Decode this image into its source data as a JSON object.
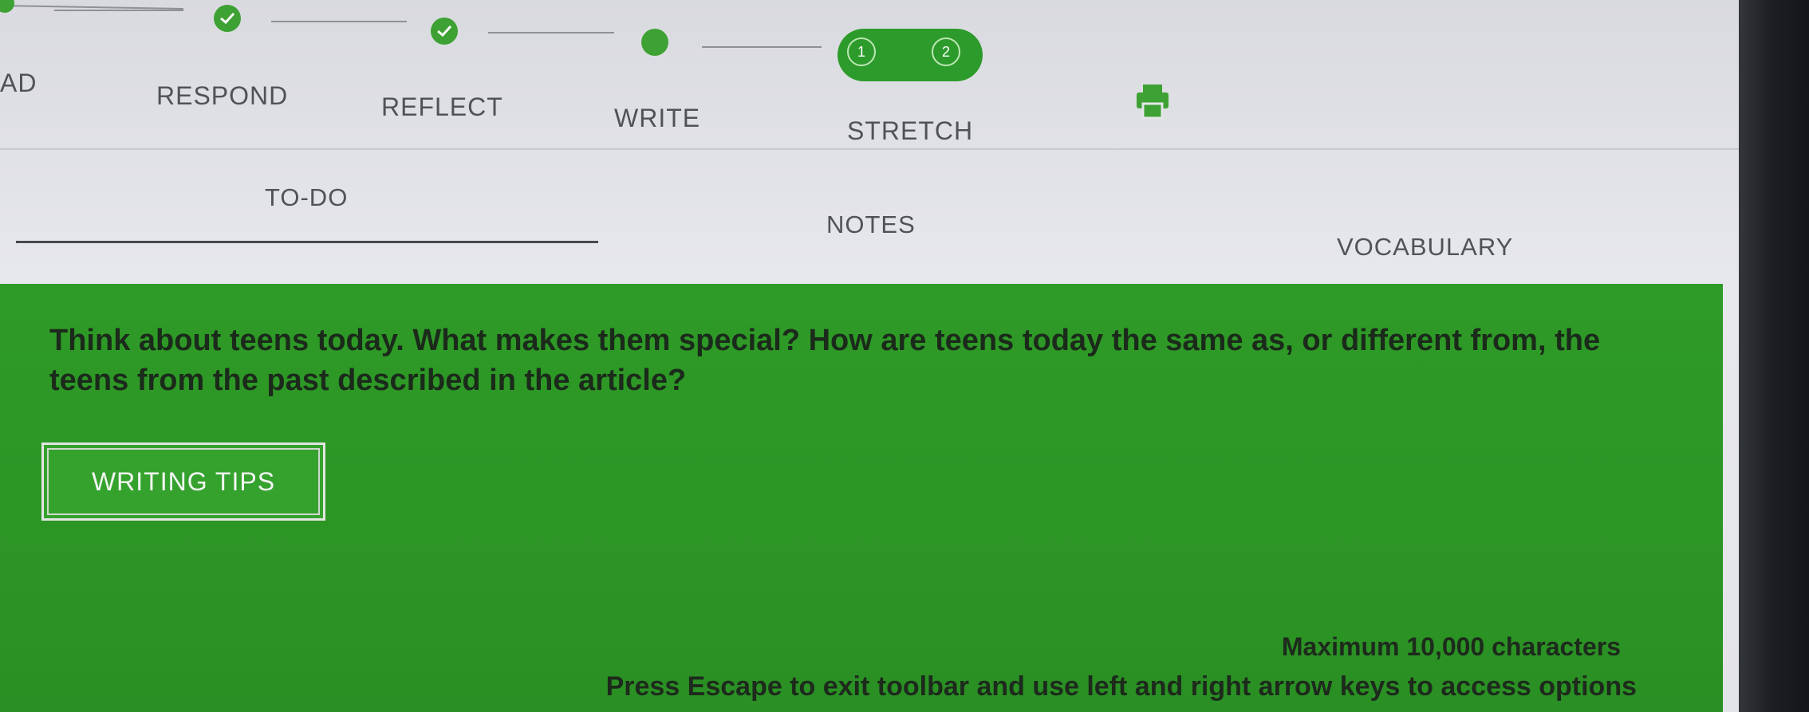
{
  "progress": {
    "steps": [
      {
        "name": "step-1",
        "state": "complete"
      },
      {
        "name": "step-2",
        "state": "complete"
      },
      {
        "name": "step-3",
        "state": "complete"
      },
      {
        "name": "step-4",
        "state": "current"
      },
      {
        "name": "step-5",
        "state": "in-progress"
      }
    ],
    "substeps": [
      "1",
      "2"
    ]
  },
  "nav": {
    "items": [
      {
        "label": "AD"
      },
      {
        "label": "RESPOND"
      },
      {
        "label": "REFLECT"
      },
      {
        "label": "WRITE"
      },
      {
        "label": "STRETCH"
      }
    ]
  },
  "tabs": [
    {
      "label": "TO-DO",
      "active": true
    },
    {
      "label": "NOTES",
      "active": false
    },
    {
      "label": "VOCABULARY",
      "active": false
    }
  ],
  "panel": {
    "prompt": "Think about teens today. What makes them special? How are teens today the same as, or different from, the teens from the past described in the article?",
    "writing_tips_label": "WRITING TIPS",
    "max_chars": "Maximum 10,000 characters",
    "escape_hint": "Press Escape to exit toolbar and use left and right arrow keys to access options"
  },
  "icons": {
    "check": "check-icon",
    "print": "printer-icon"
  },
  "colors": {
    "accent_green": "#2e9a27",
    "node_green": "#3ea133",
    "text_gray": "#4f5358"
  }
}
